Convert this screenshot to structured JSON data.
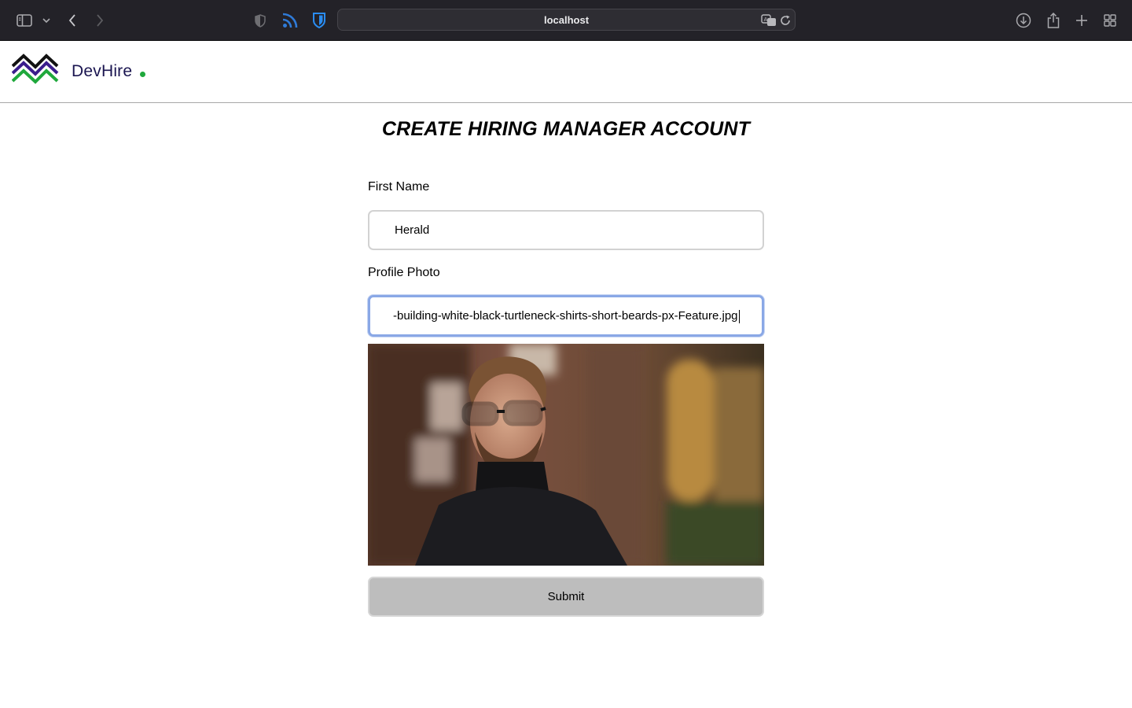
{
  "browser": {
    "url": "localhost",
    "icons": [
      "sidebar-icon",
      "chevron-down-icon",
      "back-icon",
      "forward-icon",
      "shield-icon",
      "rss-icon",
      "bitwarden-shield-icon",
      "translate-icon",
      "reload-icon",
      "download-icon",
      "share-icon",
      "new-tab-icon",
      "tab-overview-icon"
    ]
  },
  "site": {
    "brand_part1": "Dev",
    "brand_part2": "Hire",
    "brand_colors": {
      "navy": "#1a1550",
      "green": "#1fa83c",
      "purple": "#3a1d8c"
    }
  },
  "form": {
    "title": "CREATE HIRING MANAGER ACCOUNT",
    "first_name_label": "First Name",
    "first_name_value": "Herald",
    "profile_photo_label": "Profile Photo",
    "profile_photo_value": "-building-white-black-turtleneck-shirts-short-beards-px-Feature.jpg",
    "submit_label": "Submit"
  },
  "colors": {
    "focus_ring": "#8aa8e6",
    "submit_bg": "#bdbdbd",
    "chrome_bg": "#232228"
  }
}
